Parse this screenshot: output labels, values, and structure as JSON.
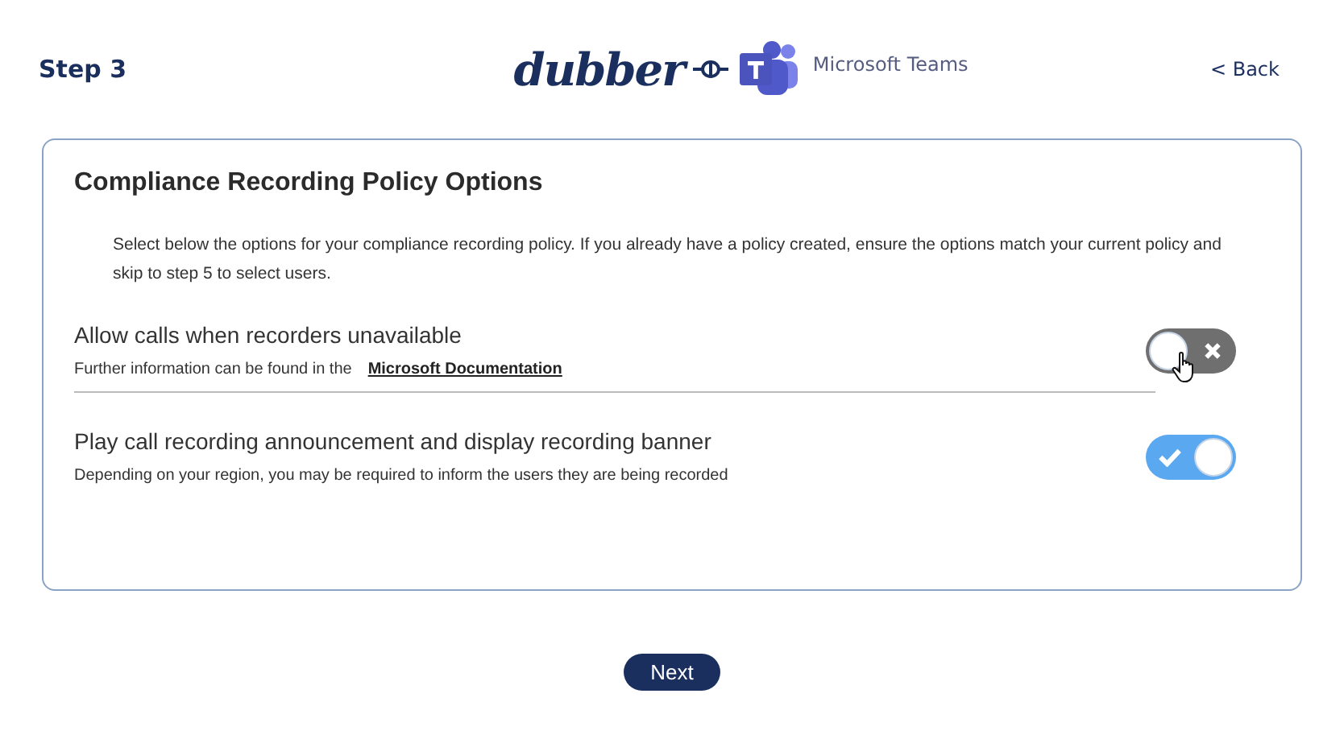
{
  "header": {
    "step": "Step 3",
    "logo_text": "dubber",
    "partner": "Microsoft Teams",
    "back": "< Back"
  },
  "card": {
    "title": "Compliance Recording Policy Options",
    "intro": "Select below the options for your compliance recording policy. If you already have a policy created, ensure the options match your current policy and skip to step 5 to select users.",
    "options": [
      {
        "title": "Allow calls when recorders unavailable",
        "description": "Further information can be found in the",
        "link": "Microsoft Documentation",
        "on": false
      },
      {
        "title": "Play call recording announcement and display recording banner",
        "description": "Depending on your region, you may be required to inform the users they are being recorded",
        "on": true
      }
    ]
  },
  "next": "Next"
}
